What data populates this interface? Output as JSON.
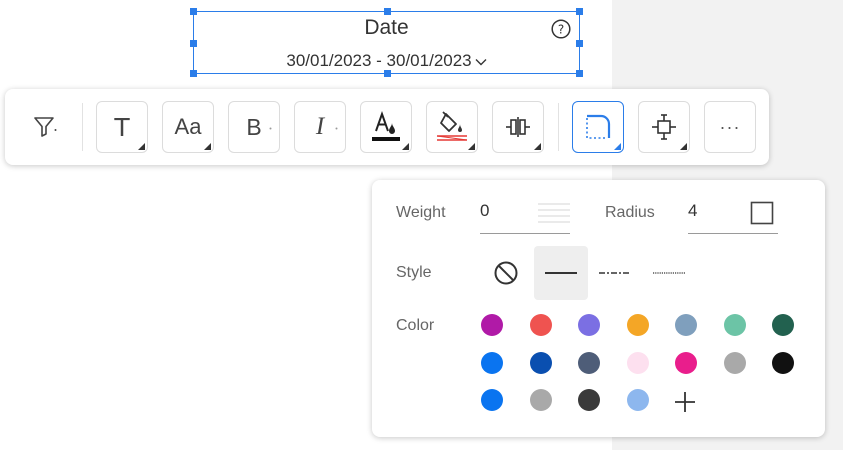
{
  "widget": {
    "title": "Date",
    "date_range": "30/01/2023 - 30/01/2023",
    "help_icon": "question-circle-icon",
    "dropdown_icon": "chevron-down-icon"
  },
  "toolbar": {
    "buttons": [
      {
        "name": "filter",
        "icon": "filter-icon"
      },
      {
        "name": "text",
        "icon": "text-icon",
        "glyph": "T"
      },
      {
        "name": "font-size",
        "icon": "font-size-icon",
        "glyph": "Aa"
      },
      {
        "name": "bold",
        "icon": "bold-icon",
        "glyph": "B"
      },
      {
        "name": "italic",
        "icon": "italic-icon",
        "glyph": "I"
      },
      {
        "name": "font-color",
        "icon": "font-color-icon"
      },
      {
        "name": "fill-color",
        "icon": "fill-bucket-icon"
      },
      {
        "name": "align",
        "icon": "align-center-icon"
      },
      {
        "name": "border",
        "icon": "border-icon",
        "active": true
      },
      {
        "name": "padding",
        "icon": "padding-icon"
      },
      {
        "name": "more",
        "icon": "more-icon",
        "glyph": "···"
      }
    ]
  },
  "border_panel": {
    "weight_label": "Weight",
    "weight_value": "0",
    "radius_label": "Radius",
    "radius_value": "4",
    "style_label": "Style",
    "styles": [
      "none",
      "solid",
      "dash-dot",
      "dotted"
    ],
    "selected_style": "solid",
    "color_label": "Color",
    "colors": [
      "#b01aa7",
      "#ef5350",
      "#7b6fe3",
      "#f4a626",
      "#7f9fbd",
      "#6cc4a6",
      "#22614f",
      "#0a74f0",
      "#0a4fb0",
      "#4e5d78",
      "#fde0ef",
      "#e91e8c",
      "#a9a9a9",
      "#111111",
      "#0a74f0",
      "#a9a9a9",
      "#3a3a3a",
      "#8db7ee"
    ],
    "add_color_icon": "plus-icon"
  }
}
